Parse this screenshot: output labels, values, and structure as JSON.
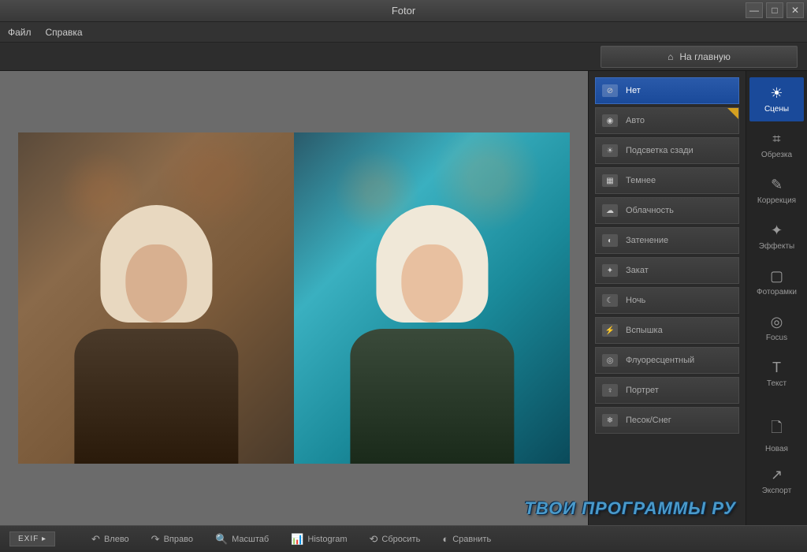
{
  "title": "Fotor",
  "menu": {
    "file": "Файл",
    "help": "Справка"
  },
  "home_button": "На главную",
  "scenes": [
    {
      "label": "Нет",
      "icon": "⊘",
      "active": true
    },
    {
      "label": "Авто",
      "icon": "◉",
      "starred": true
    },
    {
      "label": "Подсветка сзади",
      "icon": "☀"
    },
    {
      "label": "Темнее",
      "icon": "▦"
    },
    {
      "label": "Облачность",
      "icon": "☁"
    },
    {
      "label": "Затенение",
      "icon": "◐"
    },
    {
      "label": "Закат",
      "icon": "✦"
    },
    {
      "label": "Ночь",
      "icon": "☾"
    },
    {
      "label": "Вспышка",
      "icon": "⚡"
    },
    {
      "label": "Флуоресцентный",
      "icon": "◎"
    },
    {
      "label": "Портрет",
      "icon": "♀"
    },
    {
      "label": "Песок/Снег",
      "icon": "❄"
    }
  ],
  "tools": [
    {
      "label": "Сцены",
      "icon": "☀",
      "active": true
    },
    {
      "label": "Обрезка",
      "icon": "⌗"
    },
    {
      "label": "Коррекция",
      "icon": "✎"
    },
    {
      "label": "Эффекты",
      "icon": "✦"
    },
    {
      "label": "Фоторамки",
      "icon": "▢"
    },
    {
      "label": "Focus",
      "icon": "◎"
    },
    {
      "label": "Текст",
      "icon": "T"
    },
    {
      "label": "Новая",
      "icon": "🗋"
    },
    {
      "label": "Экспорт",
      "icon": "↗"
    }
  ],
  "bottom": {
    "exif": "EXIF",
    "left": "Влево",
    "right": "Вправо",
    "zoom": "Масштаб",
    "histogram": "Histogram",
    "reset": "Сбросить",
    "compare": "Сравнить"
  },
  "watermark": "ТВОИ ПРОГРАММЫ РУ"
}
